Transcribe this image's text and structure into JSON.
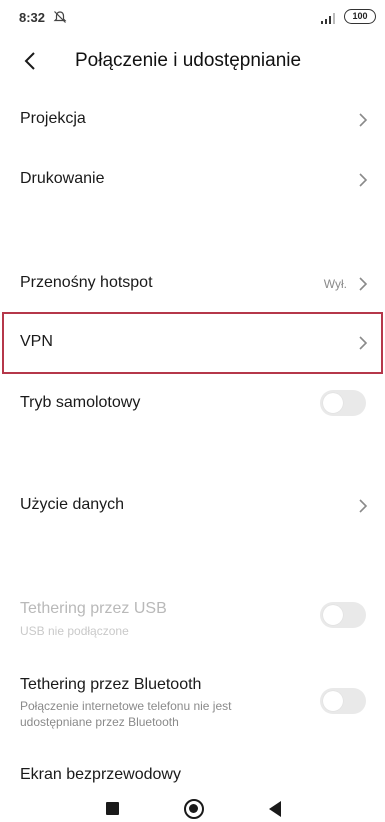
{
  "status_bar": {
    "time": "8:32",
    "battery": "100"
  },
  "header": {
    "title": "Połączenie i udostępnianie"
  },
  "items": {
    "projection": {
      "label": "Projekcja"
    },
    "printing": {
      "label": "Drukowanie"
    },
    "hotspot": {
      "label": "Przenośny hotspot",
      "value": "Wył."
    },
    "vpn": {
      "label": "VPN"
    },
    "airplane": {
      "label": "Tryb samolotowy",
      "enabled": false
    },
    "data_usage": {
      "label": "Użycie danych"
    },
    "usb_tethering": {
      "label": "Tethering przez USB",
      "subtitle": "USB nie podłączone",
      "enabled": false
    },
    "bt_tethering": {
      "label": "Tethering przez Bluetooth",
      "subtitle_line1": "Połączenie internetowe telefonu nie jest",
      "subtitle_line2": "udostępniane przez Bluetooth",
      "enabled": false
    },
    "wireless_display": {
      "label": "Ekran bezprzewodowy"
    }
  },
  "colors": {
    "highlight": "#b5374a"
  }
}
